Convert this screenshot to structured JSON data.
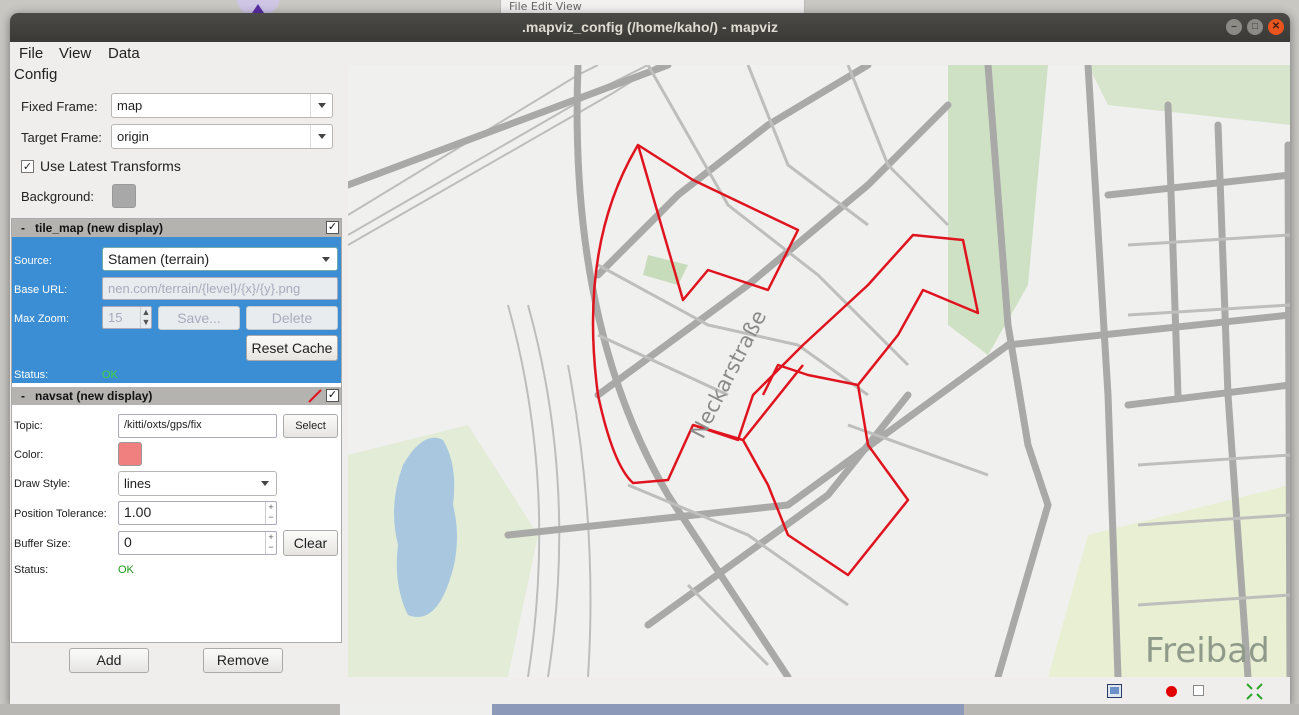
{
  "window": {
    "title": ".mapviz_config (/home/kaho/) - mapviz"
  },
  "background": {
    "top_strip_text": "File  Edit  View"
  },
  "menu": {
    "file": "File",
    "view": "View",
    "data": "Data"
  },
  "config": {
    "heading": "Config",
    "fixed_frame_label": "Fixed Frame:",
    "fixed_frame_value": "map",
    "target_frame_label": "Target Frame:",
    "target_frame_value": "origin",
    "use_latest_label": "Use Latest Transforms",
    "use_latest_checked": true,
    "background_label": "Background:",
    "background_color": "#a8a8a8"
  },
  "tile_map": {
    "title": "tile_map (new display)",
    "enabled": true,
    "source_label": "Source:",
    "source_value": "Stamen (terrain)",
    "base_url_label": "Base URL:",
    "base_url_value": "nen.com/terrain/{level}/{x}/{y}.png",
    "max_zoom_label": "Max Zoom:",
    "max_zoom_value": "15",
    "save_label": "Save...",
    "delete_label": "Delete",
    "reset_cache_label": "Reset Cache",
    "status_label": "Status:",
    "status_value": "OK"
  },
  "navsat": {
    "title": "navsat (new display)",
    "enabled": true,
    "topic_label": "Topic:",
    "topic_value": "/kitti/oxts/gps/fix",
    "select_label": "Select",
    "color_label": "Color:",
    "color_value": "#f08080",
    "draw_style_label": "Draw Style:",
    "draw_style_value": "lines",
    "position_tolerance_label": "Position Tolerance:",
    "position_tolerance_value": "1.00",
    "buffer_size_label": "Buffer Size:",
    "buffer_size_value": "0",
    "clear_label": "Clear",
    "status_label": "Status:",
    "status_value": "OK"
  },
  "buttons": {
    "add": "Add",
    "remove": "Remove"
  },
  "map": {
    "street_label": "Neckarstraße",
    "place_label": "Freibad",
    "track_color": "#e0141e"
  },
  "statusbar": {
    "icons": [
      "screenshot-icon",
      "record-icon",
      "stop-icon",
      "fit-view-icon"
    ]
  }
}
